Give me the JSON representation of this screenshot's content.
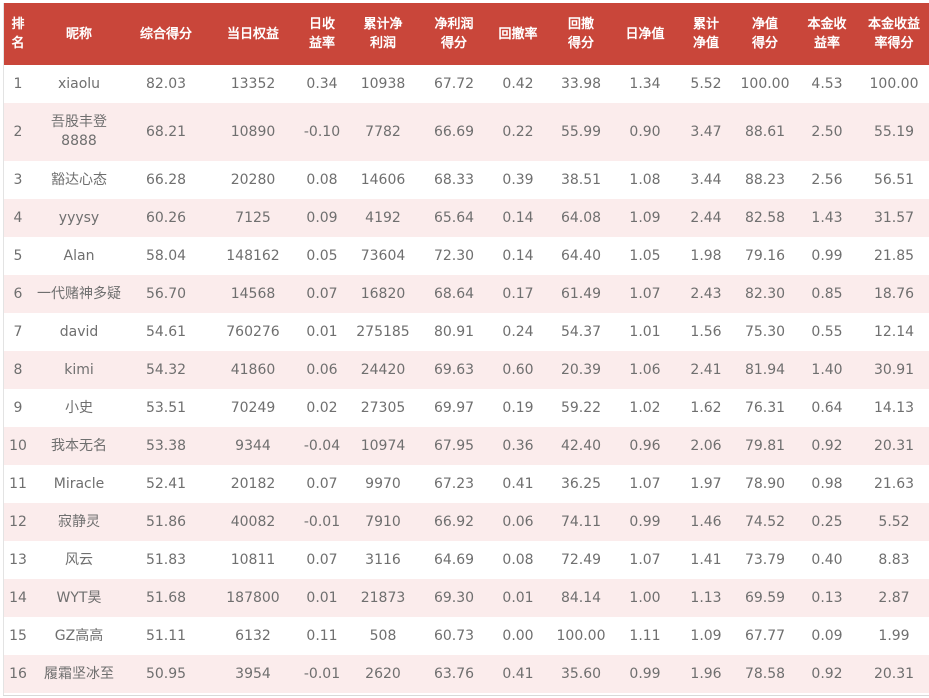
{
  "headers": [
    [
      "排",
      "名"
    ],
    [
      "昵称"
    ],
    [
      "综合得分"
    ],
    [
      "当日权益"
    ],
    [
      "日收",
      "益率"
    ],
    [
      "累计净",
      "利润"
    ],
    [
      "净利润",
      "得分"
    ],
    [
      "回撤率"
    ],
    [
      "回撤",
      "得分"
    ],
    [
      "日净值"
    ],
    [
      "累计",
      "净值"
    ],
    [
      "净值",
      "得分"
    ],
    [
      "本金收",
      "益率"
    ],
    [
      "本金收益",
      "率得分"
    ]
  ],
  "rows": [
    [
      "1",
      "xiaolu",
      "82.03",
      "13352",
      "0.34",
      "10938",
      "67.72",
      "0.42",
      "33.98",
      "1.34",
      "5.52",
      "100.00",
      "4.53",
      "100.00"
    ],
    [
      "2",
      "吾股丰登8888",
      "68.21",
      "10890",
      "-0.10",
      "7782",
      "66.69",
      "0.22",
      "55.99",
      "0.90",
      "3.47",
      "88.61",
      "2.50",
      "55.19"
    ],
    [
      "3",
      "豁达心态",
      "66.28",
      "20280",
      "0.08",
      "14606",
      "68.33",
      "0.39",
      "38.51",
      "1.08",
      "3.44",
      "88.23",
      "2.56",
      "56.51"
    ],
    [
      "4",
      "yyysy",
      "60.26",
      "7125",
      "0.09",
      "4192",
      "65.64",
      "0.14",
      "64.08",
      "1.09",
      "2.44",
      "82.58",
      "1.43",
      "31.57"
    ],
    [
      "5",
      "Alan",
      "58.04",
      "148162",
      "0.05",
      "73604",
      "72.30",
      "0.14",
      "64.40",
      "1.05",
      "1.98",
      "79.16",
      "0.99",
      "21.85"
    ],
    [
      "6",
      "一代赌神多疑",
      "56.70",
      "14568",
      "0.07",
      "16820",
      "68.64",
      "0.17",
      "61.49",
      "1.07",
      "2.43",
      "82.30",
      "0.85",
      "18.76"
    ],
    [
      "7",
      "david",
      "54.61",
      "760276",
      "0.01",
      "275185",
      "80.91",
      "0.24",
      "54.37",
      "1.01",
      "1.56",
      "75.30",
      "0.55",
      "12.14"
    ],
    [
      "8",
      "kimi",
      "54.32",
      "41860",
      "0.06",
      "24420",
      "69.63",
      "0.60",
      "20.39",
      "1.06",
      "2.41",
      "81.94",
      "1.40",
      "30.91"
    ],
    [
      "9",
      "小史",
      "53.51",
      "70249",
      "0.02",
      "27305",
      "69.97",
      "0.19",
      "59.22",
      "1.02",
      "1.62",
      "76.31",
      "0.64",
      "14.13"
    ],
    [
      "10",
      "我本无名",
      "53.38",
      "9344",
      "-0.04",
      "10974",
      "67.95",
      "0.36",
      "42.40",
      "0.96",
      "2.06",
      "79.81",
      "0.92",
      "20.31"
    ],
    [
      "11",
      "Miracle",
      "52.41",
      "20182",
      "0.07",
      "9970",
      "67.23",
      "0.41",
      "36.25",
      "1.07",
      "1.97",
      "78.90",
      "0.98",
      "21.63"
    ],
    [
      "12",
      "寂静灵",
      "51.86",
      "40082",
      "-0.01",
      "7910",
      "66.92",
      "0.06",
      "74.11",
      "0.99",
      "1.46",
      "74.52",
      "0.25",
      "5.52"
    ],
    [
      "13",
      "风云",
      "51.83",
      "10811",
      "0.07",
      "3116",
      "64.69",
      "0.08",
      "72.49",
      "1.07",
      "1.41",
      "73.79",
      "0.40",
      "8.83"
    ],
    [
      "14",
      "WYT昊",
      "51.68",
      "187800",
      "0.01",
      "21873",
      "69.30",
      "0.01",
      "84.14",
      "1.00",
      "1.13",
      "69.59",
      "0.13",
      "2.87"
    ],
    [
      "15",
      "GZ高高",
      "51.11",
      "6132",
      "0.11",
      "508",
      "60.73",
      "0.00",
      "100.00",
      "1.11",
      "1.09",
      "67.77",
      "0.09",
      "1.99"
    ],
    [
      "16",
      "履霜坚冰至",
      "50.95",
      "3954",
      "-0.01",
      "2620",
      "63.76",
      "0.41",
      "35.60",
      "0.99",
      "1.96",
      "78.58",
      "0.92",
      "20.31"
    ]
  ],
  "colors": {
    "header_bg": "#c9463a",
    "header_text": "#ffffff",
    "row_alt_bg": "#fbecec",
    "cell_text": "#6f6f6f"
  }
}
